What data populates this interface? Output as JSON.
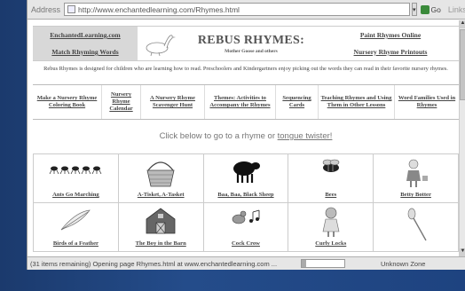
{
  "browser": {
    "address_label": "Address",
    "url": "http://www.enchantedlearning.com/Rhymes.html",
    "dropdown_glyph": "▾",
    "go_label": "Go",
    "links_label": "Links"
  },
  "header": {
    "left_links": [
      "EnchantedLearning.com",
      "Match Rhyming Words"
    ],
    "title": "REBUS RHYMES:",
    "subtitle": "Mother Goose and others",
    "right_links": [
      "Paint Rhymes Online",
      "Nursery Rhyme Printouts"
    ]
  },
  "description": "Rebus Rhymes is designed for children who are learning how to read. Preschoolers and Kindergartners enjoy picking out the words they can read in their favorite nursery rhymes.",
  "nav_links": [
    "Make a Nursery Rhyme Coloring Book",
    "Nursery Rhyme Calendar",
    "A Nursery Rhyme Scavenger Hunt",
    "Themes: Activities to Accompany the Rhymes",
    "Sequencing Cards",
    "Teaching Rhymes and Using Them in Other Lessons",
    "Word Families Used in Rhymes"
  ],
  "click_prompt": {
    "text": "Click below to go to a rhyme or ",
    "link": "tongue twister!"
  },
  "rhymes": [
    {
      "label": "Ants Go Marching",
      "icon": "ants-icon"
    },
    {
      "label": "A-Tisket, A-Tasket",
      "icon": "basket-icon"
    },
    {
      "label": "Baa, Baa, Black Sheep",
      "icon": "sheep-icon"
    },
    {
      "label": "Bees",
      "icon": "bee-icon"
    },
    {
      "label": "Betty Botter",
      "icon": "girl-icon"
    },
    {
      "label": "Birds of a Feather",
      "icon": "feather-icon"
    },
    {
      "label": "The Boy in the Barn",
      "icon": "barn-icon"
    },
    {
      "label": "Cock Crow",
      "icon": "rooster-icon"
    },
    {
      "label": "Curly Locks",
      "icon": "curly-girl-icon"
    },
    {
      "label": "",
      "icon": "spoon-icon"
    }
  ],
  "status": {
    "message": "(31 items remaining) Opening page Rhymes.html at www.enchantedlearning.com ...",
    "progress": 0.1,
    "zone": "Unknown Zone"
  },
  "colors": {
    "desktop": "#1f3f73",
    "header_left_bg": "#d8d8d8"
  }
}
